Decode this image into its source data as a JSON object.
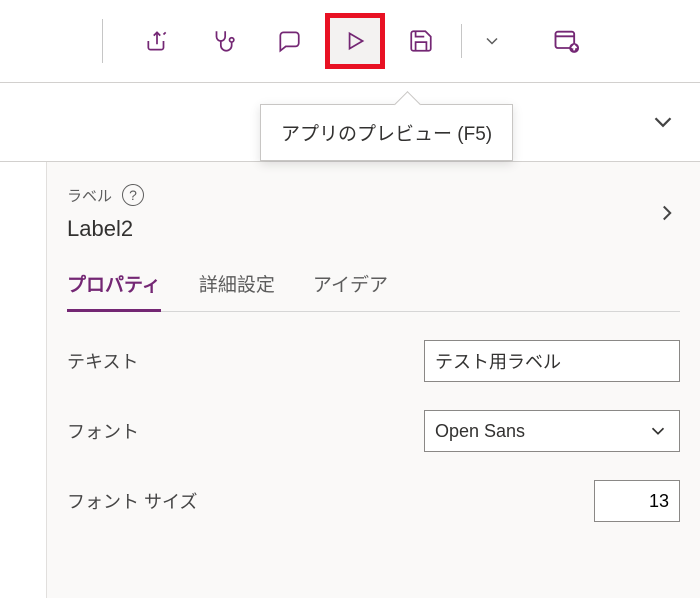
{
  "toolbar": {
    "tooltip": "アプリのプレビュー (F5)"
  },
  "panel": {
    "control_type": "ラベル",
    "control_name": "Label2",
    "tabs": {
      "properties": "プロパティ",
      "advanced": "詳細設定",
      "ideas": "アイデア"
    },
    "props": {
      "text_label": "テキスト",
      "text_value": "テスト用ラベル",
      "font_label": "フォント",
      "font_value": "Open Sans",
      "fontsize_label": "フォント サイズ",
      "fontsize_value": "13"
    }
  }
}
